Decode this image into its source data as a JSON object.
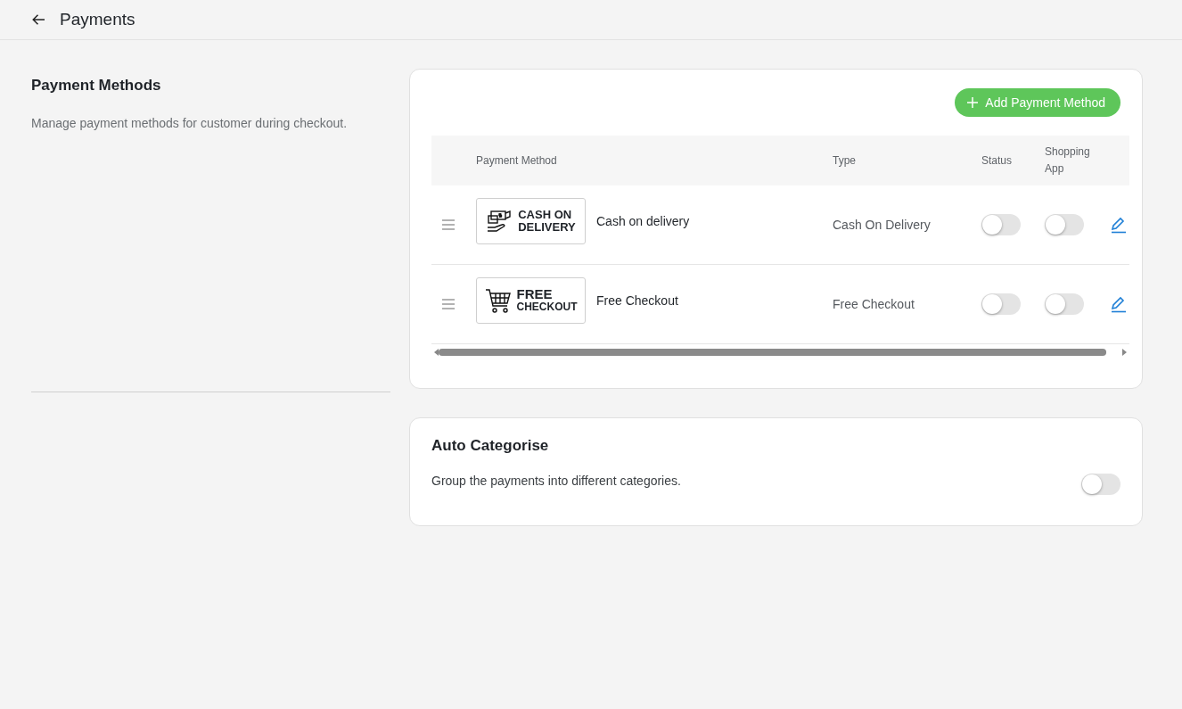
{
  "header": {
    "title": "Payments"
  },
  "section": {
    "title": "Payment Methods",
    "description": "Manage payment methods for customer during checkout."
  },
  "add_button": {
    "label": "Add Payment Method"
  },
  "table": {
    "columns": [
      "Payment Method",
      "Type",
      "Status",
      "Shopping App"
    ],
    "rows": [
      {
        "kind": "cash",
        "logo_lines": [
          "CASH ON",
          "DELIVERY"
        ],
        "name": "Cash on delivery",
        "type": "Cash On Delivery",
        "status_on": false,
        "shopping_app_on": false
      },
      {
        "kind": "cart",
        "logo_lines": [
          "FREE",
          "CHECKOUT"
        ],
        "name": "Free Checkout",
        "type": "Free Checkout",
        "status_on": false,
        "shopping_app_on": false
      }
    ]
  },
  "auto_categorise": {
    "title": "Auto Categorise",
    "description": "Group the payments into different categories.",
    "on": false
  }
}
